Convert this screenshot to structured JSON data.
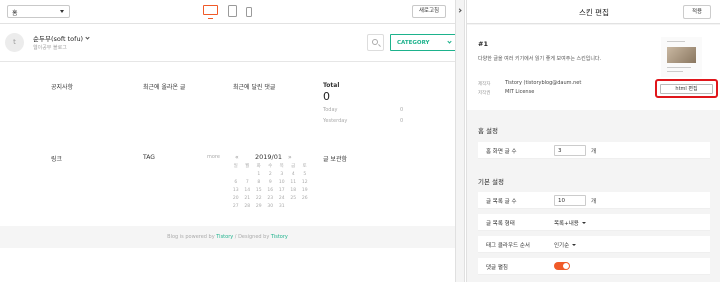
{
  "topbar": {
    "page_select_value": "홈",
    "refresh_label": "새로고침"
  },
  "blog": {
    "avatar_glyph": "t",
    "name": "순두부(soft tofu)",
    "subtitle": "웹이공부 블로그",
    "category_label": "CATEGORY"
  },
  "sections": {
    "notice": "공지사항",
    "recent_posts": "최근에 올라온 글",
    "recent_comments": "최근에 달린 댓글",
    "total_label": "Total",
    "total_value": "0",
    "today_label": "Today",
    "today_value": "0",
    "yesterday_label": "Yesterday",
    "yesterday_value": "0",
    "link": "링크",
    "tag": "TAG",
    "more": "more",
    "archive": "글 보관함"
  },
  "calendar": {
    "prev": "«",
    "next": "»",
    "title": "2019/01",
    "weekdays": [
      "일",
      "월",
      "화",
      "수",
      "목",
      "금",
      "토"
    ],
    "weeks": [
      [
        "",
        "",
        "1",
        "2",
        "3",
        "4",
        "5"
      ],
      [
        "6",
        "7",
        "8",
        "9",
        "10",
        "11",
        "12"
      ],
      [
        "13",
        "14",
        "15",
        "16",
        "17",
        "18",
        "19"
      ],
      [
        "20",
        "21",
        "22",
        "23",
        "24",
        "25",
        "26"
      ],
      [
        "27",
        "28",
        "29",
        "30",
        "31",
        "",
        ""
      ]
    ]
  },
  "footer": {
    "prefix": "Blog is powered by ",
    "brand1": "Tistory",
    "middle": " / Designed by ",
    "brand2": "Tistory"
  },
  "panel": {
    "title": "스킨 편집",
    "apply_label": "적용",
    "skin_number": "#1",
    "skin_description": "다양한 글을 여러 키기에서 읽기 좋게 보여주는 스킨입니다.",
    "maker_label": "제작자",
    "maker_value": "Tistory (tistoryblog@daum.net",
    "copyright_label": "저작권",
    "copyright_value": "MIT License",
    "html_edit_label": "html 편집",
    "home_settings_title": "홈 설정",
    "home_posts_label": "홈 화면 글 수",
    "home_posts_value": "3",
    "unit": "개",
    "basic_settings_title": "기본 설정",
    "list_count_label": "글 목록 글 수",
    "list_count_value": "10",
    "list_format_label": "글 목록 형태",
    "list_format_value": "목록+내용",
    "tag_cloud_label": "태그 클라우드 순서",
    "tag_cloud_value": "인기순",
    "comment_folding_label": "댓글 펼침"
  },
  "colors": {
    "accent_green": "#1db28c",
    "accent_orange": "#f05a28",
    "highlight_red": "#e0161b"
  }
}
